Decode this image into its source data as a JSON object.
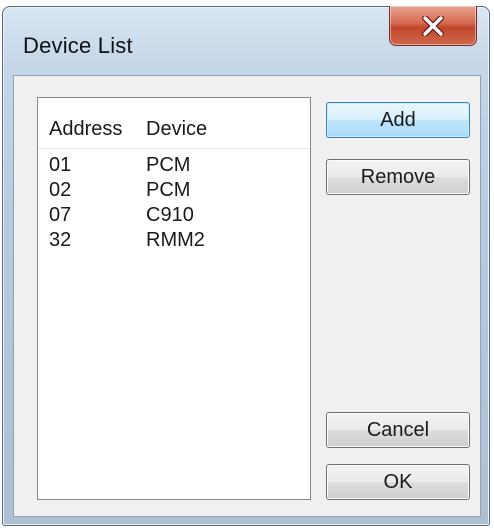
{
  "window": {
    "title": "Device List",
    "close_icon": "close-x-icon",
    "colors": {
      "close_button": "#c94f37",
      "default_button_border": "#3c7fb1"
    }
  },
  "list": {
    "columns": {
      "address": "Address",
      "device": "Device"
    },
    "rows": [
      {
        "address": "01",
        "device": "PCM"
      },
      {
        "address": "02",
        "device": "PCM"
      },
      {
        "address": "07",
        "device": "C910"
      },
      {
        "address": "32",
        "device": "RMM2"
      }
    ]
  },
  "buttons": {
    "add": "Add",
    "remove": "Remove",
    "cancel": "Cancel",
    "ok": "OK"
  }
}
